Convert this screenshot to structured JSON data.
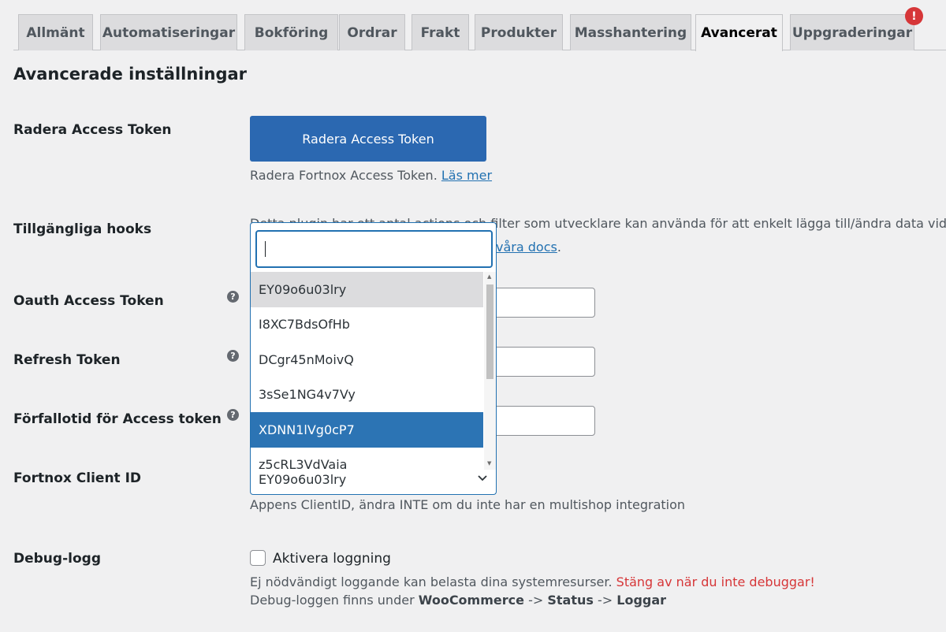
{
  "tabs": [
    {
      "label": "Allmänt"
    },
    {
      "label": "Automatiseringar"
    },
    {
      "label": "Bokföring"
    },
    {
      "label": "Ordrar"
    },
    {
      "label": "Frakt"
    },
    {
      "label": "Produkter"
    },
    {
      "label": "Masshantering"
    },
    {
      "label": "Avancerat",
      "active": true
    },
    {
      "label": "Uppgraderingar"
    }
  ],
  "badge": "!",
  "section_title": "Avancerade inställningar",
  "radera": {
    "label": "Radera Access Token",
    "button": "Radera Access Token",
    "desc": "Radera Fortnox Access Token.",
    "link": "Läs mer"
  },
  "hooks": {
    "label": "Tillgängliga hooks",
    "desc": "Detta plugin har ett antal actions och filter som utvecklare kan använda för att enkelt lägga till/ändra data vid olika",
    "link": "våra docs"
  },
  "oauth": {
    "label": "Oauth Access Token"
  },
  "refresh": {
    "label": "Refresh Token"
  },
  "expiry": {
    "label": "Förfallotid för Access token"
  },
  "client_id": {
    "label": "Fortnox Client ID",
    "selected": "EY09o6u03lry",
    "desc": "Appens ClientID, ändra INTE om du inte har en multishop integration"
  },
  "dropdown": {
    "search_value": "",
    "options": [
      "EY09o6u03lry",
      "I8XC7BdsOfHb",
      "DCgr45nMoivQ",
      "3sSe1NG4v7Vy",
      "XDNN1lVg0cP7",
      "z5cRL3VdVaia"
    ]
  },
  "debug": {
    "label": "Debug-logg",
    "checkbox_label": "Aktivera loggning",
    "desc1": "Ej nödvändigt loggande kan belasta dina systemresurser.",
    "desc1_warning": "Stäng av när du inte debuggar!",
    "desc2_prefix": "Debug-loggen finns under",
    "desc2_a": "WooCommerce",
    "desc2_arrow1": "->",
    "desc2_b": "Status",
    "desc2_arrow2": "->",
    "desc2_c": "Loggar"
  },
  "help_icon": "?",
  "colors": {
    "primary": "#2b68b1",
    "link": "#2271b1",
    "warning": "#d63638",
    "selected": "#2c74b4"
  }
}
